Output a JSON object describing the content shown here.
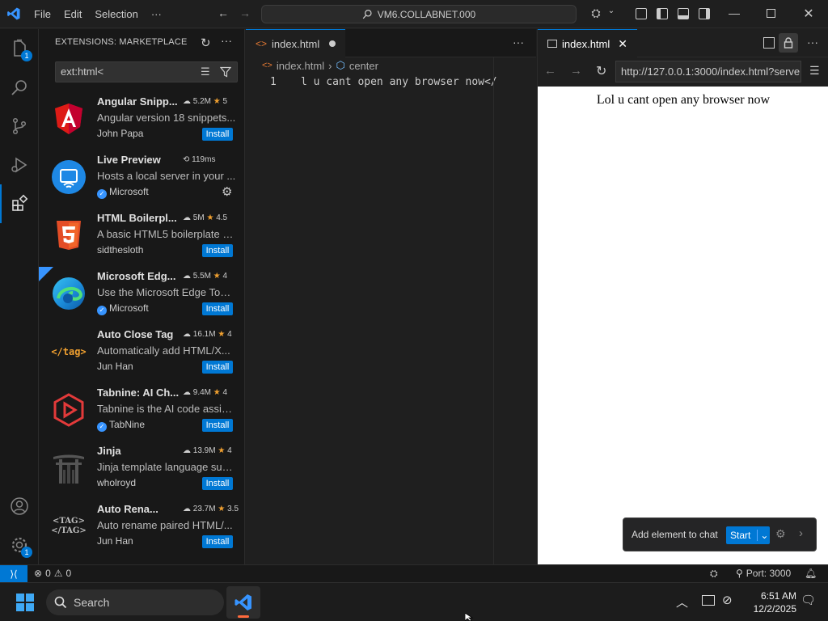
{
  "titlebar": {
    "menu": [
      "File",
      "Edit",
      "Selection",
      "···"
    ],
    "command_center": "VM6.COLLABNET.000"
  },
  "activity": {
    "explorer_badge": "1",
    "manage_badge": "1"
  },
  "sidebar": {
    "title": "EXTENSIONS: MARKETPLACE",
    "search_value": "ext:html<",
    "extensions": [
      {
        "name": "Angular Snipp...",
        "stat": "5.2M",
        "rating": "5",
        "desc": "Angular version 18 snippets...",
        "publisher": "John Papa",
        "verified": false,
        "action": "Install"
      },
      {
        "name": "Live Preview",
        "stat": "119ms",
        "rating": "",
        "desc": "Hosts a local server in your ...",
        "publisher": "Microsoft",
        "verified": true,
        "action": ""
      },
      {
        "name": "HTML Boilerpl...",
        "stat": "5M",
        "rating": "4.5",
        "desc": "A basic HTML5 boilerplate s...",
        "publisher": "sidthesloth",
        "verified": false,
        "action": "Install"
      },
      {
        "name": "Microsoft Edg...",
        "stat": "5.5M",
        "rating": "4",
        "desc": "Use the Microsoft Edge Tool...",
        "publisher": "Microsoft",
        "verified": true,
        "action": "Install"
      },
      {
        "name": "Auto Close Tag",
        "stat": "16.1M",
        "rating": "4",
        "desc": "Automatically add HTML/X...",
        "publisher": "Jun Han",
        "verified": false,
        "action": "Install"
      },
      {
        "name": "Tabnine: AI Ch...",
        "stat": "9.4M",
        "rating": "4",
        "desc": "Tabnine is the AI code assist...",
        "publisher": "TabNine",
        "verified": true,
        "action": "Install"
      },
      {
        "name": "Jinja",
        "stat": "13.9M",
        "rating": "4",
        "desc": "Jinja template language sup...",
        "publisher": "wholroyd",
        "verified": false,
        "action": "Install"
      },
      {
        "name": "Auto Rena...",
        "stat": "23.7M",
        "rating": "3.5",
        "desc": "Auto rename paired HTML/...",
        "publisher": "Jun Han",
        "verified": false,
        "action": "Install"
      }
    ]
  },
  "editor": {
    "tab_label": "index.html",
    "breadcrumb_file": "index.html",
    "breadcrumb_symbol": "center",
    "line_number": "1",
    "line_text": "l u cant open any browser now</"
  },
  "preview": {
    "tab_label": "index.html",
    "url": "http://127.0.0.1:3000/index.html?serverWindowId",
    "page_text": "Lol u cant open any browser now",
    "chat_label": "Add element to chat",
    "start_label": "Start"
  },
  "statusbar": {
    "errors": "0",
    "warnings": "0",
    "port": "Port: 3000"
  },
  "taskbar": {
    "search_placeholder": "Search",
    "time": "6:51 AM",
    "date": "12/2/2025"
  },
  "colors": {
    "accent": "#0078d4",
    "star": "#f0a030"
  }
}
